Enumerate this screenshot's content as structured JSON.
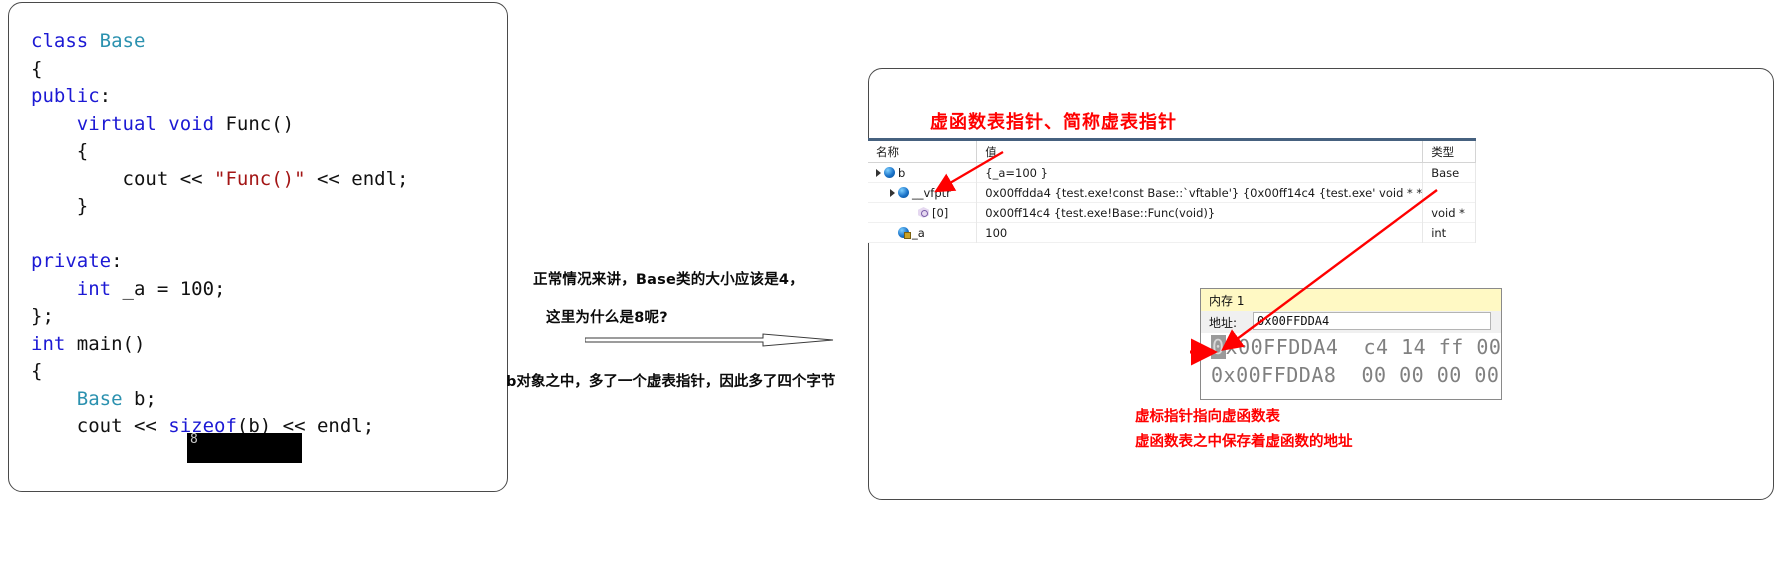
{
  "code_card": {
    "lines": [
      [
        {
          "t": "class ",
          "c": "kw"
        },
        {
          "t": "Base",
          "c": "ty"
        }
      ],
      [
        {
          "t": "{",
          "c": "pl"
        }
      ],
      [
        {
          "t": "public",
          "c": "kw"
        },
        {
          "t": ":",
          "c": "pl"
        }
      ],
      [
        {
          "t": "    ",
          "c": "pl"
        },
        {
          "t": "virtual void ",
          "c": "kw"
        },
        {
          "t": "Func()",
          "c": "pl"
        }
      ],
      [
        {
          "t": "    {",
          "c": "pl"
        }
      ],
      [
        {
          "t": "        cout << ",
          "c": "pl"
        },
        {
          "t": "\"Func()\"",
          "c": "str"
        },
        {
          "t": " << endl;",
          "c": "pl"
        }
      ],
      [
        {
          "t": "    }",
          "c": "pl"
        }
      ],
      [
        {
          "t": "",
          "c": "pl"
        }
      ],
      [
        {
          "t": "private",
          "c": "kw"
        },
        {
          "t": ":",
          "c": "pl"
        }
      ],
      [
        {
          "t": "    ",
          "c": "pl"
        },
        {
          "t": "int ",
          "c": "kw"
        },
        {
          "t": "_a = 100;",
          "c": "pl"
        }
      ],
      [
        {
          "t": "};",
          "c": "pl"
        }
      ],
      [
        {
          "t": "int ",
          "c": "kw"
        },
        {
          "t": "main()",
          "c": "pl"
        }
      ],
      [
        {
          "t": "{",
          "c": "pl"
        }
      ],
      [
        {
          "t": "    ",
          "c": "pl"
        },
        {
          "t": "Base",
          "c": "ty"
        },
        {
          "t": " b;",
          "c": "pl"
        }
      ],
      [
        {
          "t": "    cout << ",
          "c": "pl"
        },
        {
          "t": "sizeof",
          "c": "kw"
        },
        {
          "t": "(b) << endl;",
          "c": "pl"
        }
      ]
    ],
    "console_output": "8"
  },
  "middle": {
    "line1": "正常情况来讲，Base类的大小应该是4，",
    "line2": "这里为什么是8呢?",
    "line3": "b对象之中，多了一个虚表指针，因此多了四个字节"
  },
  "vs": {
    "title": "虚函数表指针、简称虚表指针",
    "watch": {
      "headers": [
        "名称",
        "值",
        "类型"
      ],
      "rows": [
        {
          "indent": 1,
          "expander": true,
          "icon": "object-icon",
          "name": "b",
          "value": "{_a=100 }",
          "type": "Base"
        },
        {
          "indent": 2,
          "expander": true,
          "icon": "object-icon",
          "name": "__vfptr",
          "value": "0x00ffdda4 {test.exe!const Base::`vftable'} {0x00ff14c4 {test.exe'  void * *",
          "type": ""
        },
        {
          "indent": 3,
          "expander": false,
          "icon": "pointer-icon",
          "name": "[0]",
          "value": "0x00ff14c4 {test.exe!Base::Func(void)}",
          "type": "void *"
        },
        {
          "indent": 2,
          "expander": false,
          "icon": "private-field-icon",
          "name": "_a",
          "value": "100",
          "type": "int"
        }
      ]
    },
    "memory": {
      "title": "内存 1",
      "address_label": "地址:",
      "address_value": "0x00FFDDA4",
      "rows": [
        {
          "addr_sel": "0",
          "addr_rest": "x00FFDDA4",
          "bytes": "c4 14 ff 00"
        },
        {
          "addr_sel": "",
          "addr_rest": "0x00FFDDA8",
          "bytes": "00 00 00 00"
        }
      ]
    },
    "bottom_note_line1": "虚标指针指向虚函数表",
    "bottom_note_line2": "虚函数表之中保存着虚函数的地址"
  },
  "colors": {
    "annotation_red": "#ff0000",
    "keyword_blue": "#1c19d4",
    "type_teal": "#2b91af",
    "string_red": "#a31515",
    "table_header_bar": "#46617f",
    "memory_title_yellow": "#fff9c4"
  }
}
